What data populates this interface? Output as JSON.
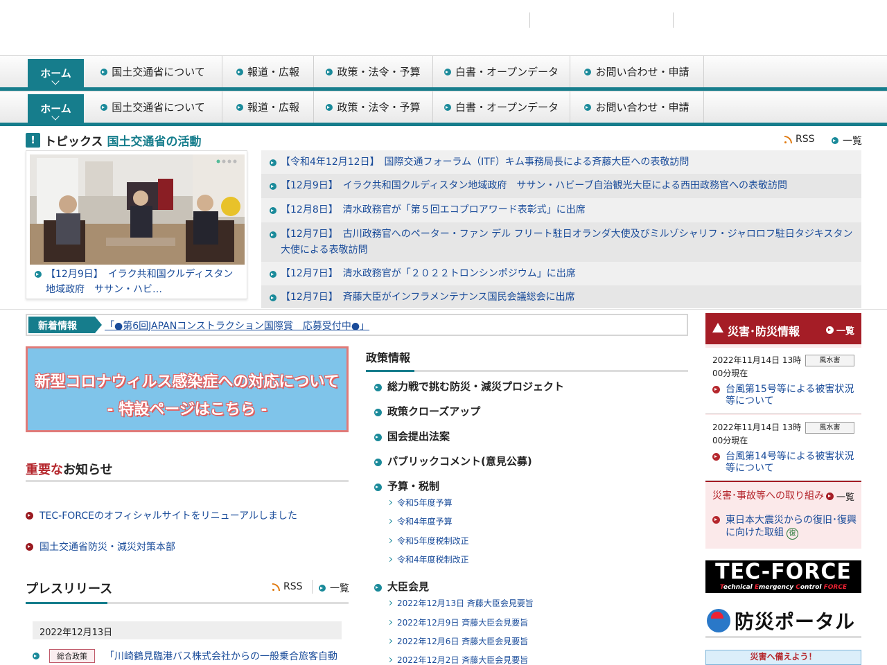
{
  "nav": {
    "home": "ホーム",
    "items": [
      "国土交通省について",
      "報道・広報",
      "政策・法令・予算",
      "白書・オープンデータ",
      "お問い合わせ・申請"
    ]
  },
  "topics": {
    "title": "トピックス",
    "subtitle": "国土交通省の活動",
    "rss": "RSS",
    "list": "一覧",
    "feature_caption": "【12月9日】　イラク共和国クルディスタン地域政府　ササン・ハビ…",
    "items": [
      "【令和4年12月12日】　国際交通フォーラム（ITF）キム事務局長による斉藤大臣への表敬訪問",
      "【12月9日】　イラク共和国クルディスタン地域政府　ササン・ハビーブ自治観光大臣による西田政務官への表敬訪問",
      "【12月8日】　清水政務官が「第５回エコプロアワード表彰式」に出席",
      "【12月7日】　古川政務官へのペーター・ファン デル フリート駐日オランダ大使及びミルゾシャリフ・ジャロロフ駐日タジキスタン大使による表敬訪問",
      "【12月7日】　清水政務官が「２０２２トロンシンポジウム」に出席",
      "【12月7日】　斉藤大臣がインフラメンテナンス国民会議総会に出席"
    ]
  },
  "news": {
    "label": "新着情報",
    "text": "「●第6回JAPANコンストラクション国際賞　応募受付中●」"
  },
  "corona": {
    "line1": "新型コロナウィルス感染症への対応について",
    "line2": "- 特設ページはこちら -"
  },
  "important": {
    "title_red": "重要な",
    "title_rest": "お知らせ",
    "items": [
      "TEC-FORCEのオフィシャルサイトをリニューアルしました",
      "国土交通省防災・減災対策本部"
    ]
  },
  "press": {
    "title": "プレスリリース",
    "rss": "RSS",
    "list": "一覧",
    "date": "2022年12月13日",
    "tag": "総合政策",
    "item": "「川崎鶴見臨港バス株式会社からの一般乗合旅客自動"
  },
  "policy": {
    "title": "政策情報",
    "items": [
      "総力戦で挑む防災・減災プロジェクト",
      "政策クローズアップ",
      "国会提出法案",
      "パブリックコメント(意見公募)",
      "予算・税制"
    ],
    "budget_sub": [
      "令和5年度予算",
      "令和4年度予算",
      "令和5年度税制改正",
      "令和4年度税制改正"
    ],
    "minister_title": "大臣会見",
    "minister_sub": [
      "2022年12月13日 斉藤大臣会見要旨",
      "2022年12月9日 斉藤大臣会見要旨",
      "2022年12月6日 斉藤大臣会見要旨",
      "2022年12月2日 斉藤大臣会見要旨"
    ]
  },
  "disaster": {
    "title": "災害･防災情報",
    "more": "一覧",
    "cards": [
      {
        "date": "2022年11月14日 13時00分現在",
        "tag": "風水害",
        "link": "台風第15号等による被害状況等について"
      },
      {
        "date": "2022年11月14日 13時00分現在",
        "tag": "風水害",
        "link": "台風第14号等による被害状況等について"
      }
    ],
    "sub_title": "災害･事故等への取り組み",
    "sub_more": "一覧",
    "recovery": "東日本大震災からの復旧･復興に向けた取組",
    "recovery_badge": "復"
  },
  "banners": {
    "tecforce_big": "TEC-FORCE",
    "tecforce_small_1": "T",
    "tecforce_small_2": "echnical ",
    "tecforce_small_3": "E",
    "tecforce_small_4": "mergency ",
    "tecforce_small_5": "C",
    "tecforce_small_6": "ontrol ",
    "tecforce_small_7": "FORCE",
    "bosai": "防災ポータル",
    "prepare": "災害へ備えよう！"
  }
}
